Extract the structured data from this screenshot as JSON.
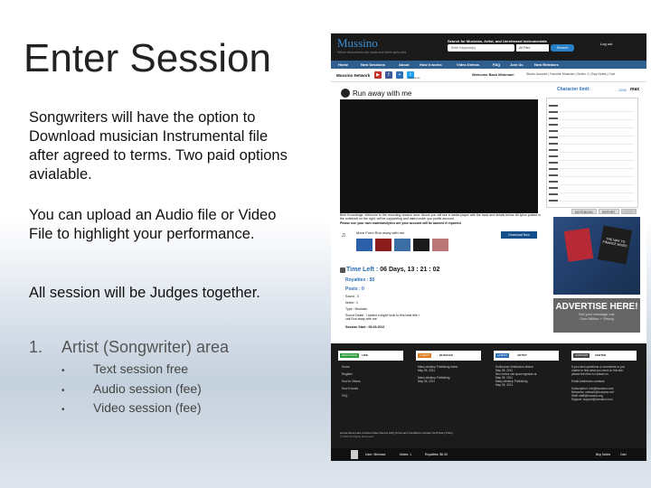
{
  "slide": {
    "title": "Enter Session",
    "paragraph1": "Songwriters will have the option to Download musician Instrumental file after agreed to terms. Two paid options avialable.",
    "paragraph2": "You can upload an Audio file or Video File to highlight your performance.",
    "paragraph3": "All session will be Judges together.",
    "list_number": "1.",
    "list_item": "Artist (Songwriter) area",
    "bullets": [
      "Text session free",
      "Audio session (fee)",
      "Video session (fee)"
    ],
    "bullet_symbol": "•"
  },
  "site": {
    "logo": "Mussino",
    "logo_tagline": "Where discoveries are made and talent gets paid",
    "search_label": "Search for Musician, Artist, and Unreleased Instrumentals",
    "search_placeholder": "Enter Keyword(s)",
    "search_select": "All Files",
    "search_button": "Search",
    "logout": "Log out",
    "nav": [
      "Home",
      "New Sessions",
      "About",
      "How it works",
      "Video Demos",
      "FAQ",
      "Join Us",
      "New Releases"
    ],
    "network_label": "Mussino Network",
    "follow": "Follow us",
    "welcome": "Welcome Back Minimax!",
    "account_links": "Studio Account | Favorite Musician | Notes: 1 | Buy Notes | Cart",
    "session_title": "Run away with me",
    "char_limit_label": "Character limit:",
    "char_limit_value": "1200",
    "char_limit_max": "max",
    "notebook_tabs": [
      "NOTEBOOK",
      "REPORT",
      "POST"
    ],
    "brief": "Brief Knowledge: Welcome to the recording session area. Above you will see a media player with the track and details below. All lyrics posted in the notebook on the right, will be copywriting and dated under you profile account.",
    "brief_warning": "Please use your own materials/lyrics are your account will be banned if reported.",
    "more_from": "More Form Run away with me",
    "download": "Download Now",
    "time_left_label": "Time Left :",
    "time_left_value": "06 Days, 13 : 21 : 02",
    "royalties": "Royalties : $0",
    "posts": "Posts : 0",
    "sound": "Sound : 0",
    "notes": "Notes : 1",
    "type": "Type : Musician",
    "sound_detail": "Sound Detail : I added a slight hook to this beat title I call Run away with me",
    "session_start": "Session Start : 05-09-2012",
    "ad_jeans_text": "THE WAY TO FINANCE MUSIC",
    "ad_heading": "ADVERTISE HERE!",
    "ad_sub": "Get your message out.",
    "ad_note": "Over Million + Strong",
    "footer_boxes": [
      {
        "badge": "RESOURCE",
        "label": "LINK",
        "color": "#2f9c3c"
      },
      {
        "badge": "LATEST",
        "label": "MUSICIAN",
        "color": "#e07a1f"
      },
      {
        "badge": "LATEST",
        "label": "ARTIST",
        "color": "#2d6fb7"
      },
      {
        "badge": "SUPPORT",
        "label": "CENTER",
        "color": "#444444"
      }
    ],
    "footer_col1": [
      "Home",
      "Register",
      "How to Videos",
      "How it works",
      "FAQ"
    ],
    "footer_col2": [
      "Many desktop Publishing latest",
      "May 05, 2011",
      "Many desktop Publishing",
      "May 05, 2011"
    ],
    "footer_col3": [
      "Dolibudum Vestibulum dictum",
      "May 05, 2011",
      "Nec metus nisl quam egestas at",
      "May 05, 2011",
      "Many desktop Publishing",
      "May 05, 2011"
    ],
    "footer_col4": [
      "If you have questions or comments or you",
      "unable to find what you need on this site,",
      "please feel free to contact us.",
      "",
      "Email Addresses contacts",
      "",
      "Subscription: info@mussino.com",
      "Networks: network@mussino.net",
      "Staff: staff@mussino.org",
      "Support: support@mussino.com"
    ],
    "footer_links": "Home   About   How it works   Video Demos   FAQ   Terms and Conditions   Contact Us   Privacy Policy",
    "footer_copy": "© 2012  All Rights Reserved",
    "bottom_user": "User: Minimax",
    "bottom_notes": "Notes: 1",
    "bottom_royalties": "Royalties: $0.00",
    "bottom_buy": "Buy Notes",
    "bottom_cart": "Cart"
  }
}
